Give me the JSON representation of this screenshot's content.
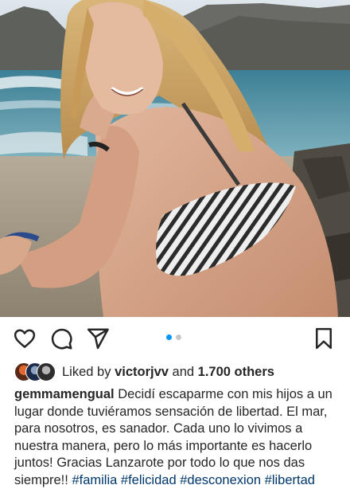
{
  "post": {
    "photo": {
      "description_icon": "beach-photo",
      "colors": {
        "sky": "#c9d6e0",
        "mountain": "#5b5d5a",
        "sea": "#4f93a8",
        "sand": "#a39682",
        "skin": "#d7a58a",
        "hair": "#c49a5a"
      }
    },
    "actions": {
      "like_icon": "heart-icon",
      "comment_icon": "comment-icon",
      "share_icon": "paper-plane-icon",
      "save_icon": "bookmark-icon"
    },
    "carousel": {
      "count": 2,
      "active": 1
    },
    "likes": {
      "prefix": "Liked by",
      "user": "victorjvv",
      "connector": "and",
      "others": "1.700 others"
    },
    "caption": {
      "username": "gemmamengual",
      "text": "Decidí escaparme con mis hijos a un lugar donde tuviéramos sensación de libertad. El mar, para nosotros, es sanador. Cada uno lo vivimos a nuestra manera, pero lo más importante es hacerlo juntos! Gracias Lanzarote por todo lo que nos das siempre!!",
      "hashtags": [
        "#familia",
        "#felicidad",
        "#desconexion",
        "#libertad"
      ]
    }
  },
  "colors": {
    "link": "#00376b",
    "accent": "#0095f6",
    "text": "#262626"
  }
}
